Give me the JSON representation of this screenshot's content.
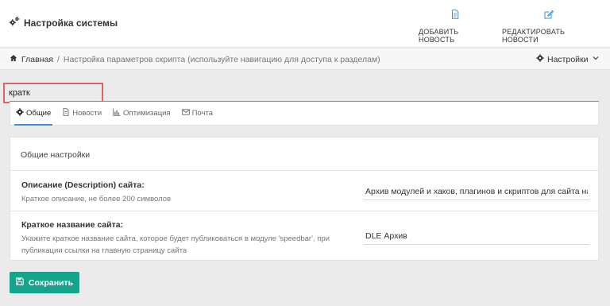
{
  "header": {
    "title": "Настройка системы",
    "actions": [
      {
        "label": "ДОБАВИТЬ НОВОСТЬ",
        "icon": "document-icon"
      },
      {
        "label": "РЕДАКТИРОВАТЬ НОВОСТИ",
        "icon": "edit-icon"
      }
    ]
  },
  "breadcrumb": {
    "home": "Главная",
    "separator": "/",
    "current": "Настройка параметров скрипта (используйте навигацию для доступа к разделам)"
  },
  "settings_menu": {
    "label": "Настройки"
  },
  "search": {
    "value": "кратк"
  },
  "tabs": [
    {
      "label": "Общие",
      "icon": "gear-icon",
      "active": true
    },
    {
      "label": "Новости",
      "icon": "file-icon",
      "active": false
    },
    {
      "label": "Оптимизация",
      "icon": "bar-chart-icon",
      "active": false
    },
    {
      "label": "Почта",
      "icon": "envelope-icon",
      "active": false
    }
  ],
  "panel": {
    "title": "Общие настройки",
    "fields": [
      {
        "label": "Описание (Description) сайта:",
        "help": "Краткое описание, не более 200 символов",
        "value": "Архив модулей и хаков, плагинов и скриптов для сайта на движке DLE"
      },
      {
        "label": "Краткое название сайта:",
        "help": "Укажите краткое название сайта, которое будет публиковаться в модуле 'speedbar', при публикации ссылки на главную страницу сайта",
        "value": "DLE Архив"
      }
    ]
  },
  "save_button": {
    "label": "Сохранить"
  },
  "colors": {
    "accent": "#13a48b",
    "highlight": "#e06464",
    "active_tab": "#3f8fd2"
  }
}
